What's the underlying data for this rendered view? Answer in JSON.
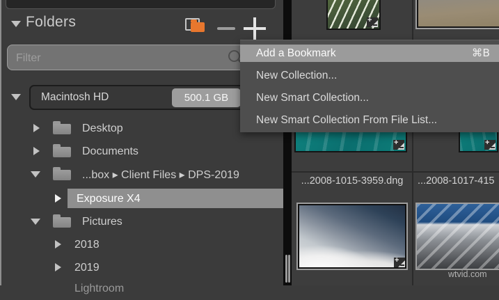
{
  "panel": {
    "title": "Folders",
    "filter": {
      "placeholder": "Filter"
    },
    "header_icons": {
      "disclosure": "triangle-down",
      "add_folder": "orange-folder-add",
      "collapse": "minus",
      "expand": "plus"
    }
  },
  "tree": {
    "volume": {
      "label": "Macintosh HD",
      "capacity": "500.1 GB",
      "expanded": true
    },
    "items": [
      {
        "label": "Desktop",
        "level": 1,
        "disclosure": "collapsed",
        "icon": "folder"
      },
      {
        "label": "Documents",
        "level": 1,
        "disclosure": "collapsed",
        "icon": "folder"
      },
      {
        "label": "...box ▸ Client Files ▸ DPS-2019",
        "level": 1,
        "disclosure": "expanded",
        "icon": "folder"
      },
      {
        "label": "Exposure X4",
        "level": 2,
        "disclosure": "collapsed",
        "selected": true
      },
      {
        "label": "Pictures",
        "level": 1,
        "disclosure": "expanded",
        "icon": "folder"
      },
      {
        "label": "2018",
        "level": 2,
        "disclosure": "collapsed"
      },
      {
        "label": "2019",
        "level": 2,
        "disclosure": "collapsed"
      },
      {
        "label": "Lightroom",
        "level": 2,
        "partial": true
      }
    ]
  },
  "menu": {
    "items": [
      {
        "label": "Add a Bookmark",
        "shortcut": "⌘B",
        "highlighted": true
      },
      {
        "label": "New Collection...",
        "shortcut": ""
      },
      {
        "label": "New Smart Collection...",
        "shortcut": ""
      },
      {
        "label": "New Smart Collection From File List...",
        "shortcut": ""
      }
    ]
  },
  "browser": {
    "files": [
      {
        "name": "...2008-1015-3959.dng"
      },
      {
        "name": "...2008-1017-415"
      }
    ],
    "thumbnails": [
      "leaf",
      "sand-wave",
      "ocean-teal",
      "ocean-teal",
      "mountain-in-clouds",
      "snow-mountain"
    ],
    "edit_badge_icon": "adjustments-applied"
  },
  "watermark": "wtvid.com",
  "colors": {
    "accent_orange": "#e8772e",
    "panel_bg": "#3b3b3b",
    "menu_bg": "#4e4e4e",
    "menu_highlight": "#9b9b9b",
    "selection_bg": "#8f8f8f",
    "scroll_track": "#0c0c0c"
  }
}
